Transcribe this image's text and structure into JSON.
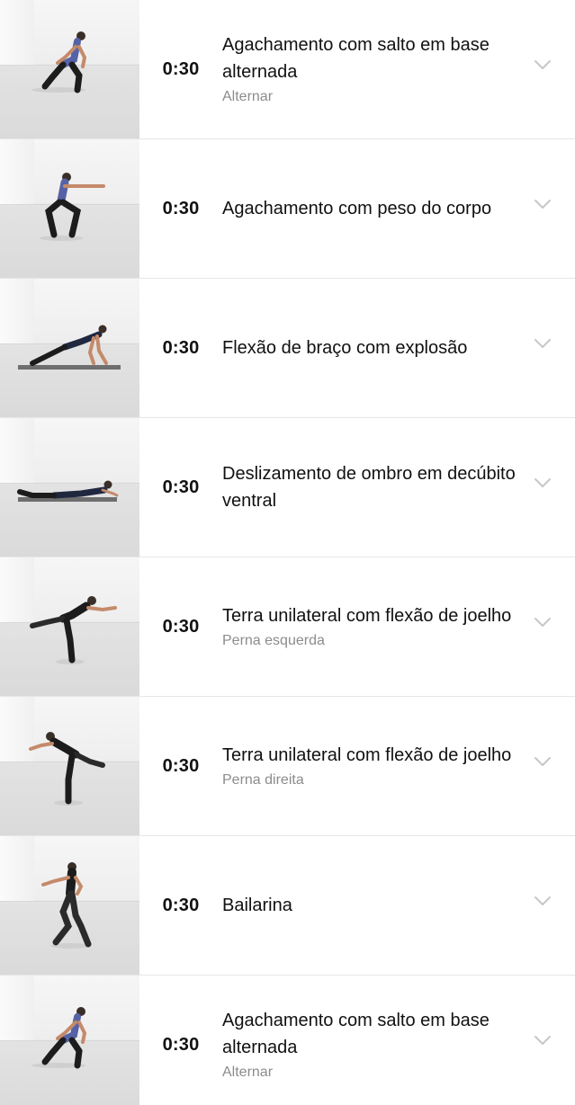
{
  "exercises": [
    {
      "time": "0:30",
      "name": "Agachamento com salto em base alternada",
      "sub": "Alternar",
      "thumb_icon": "split-squat-jump-figure"
    },
    {
      "time": "0:30",
      "name": "Agachamento com peso do corpo",
      "sub": "",
      "thumb_icon": "bodyweight-squat-figure"
    },
    {
      "time": "0:30",
      "name": "Flexão de braço com explosão",
      "sub": "",
      "thumb_icon": "plyo-pushup-figure"
    },
    {
      "time": "0:30",
      "name": "Deslizamento de ombro em decúbito ventral",
      "sub": "",
      "thumb_icon": "prone-shoulder-slide-figure"
    },
    {
      "time": "0:30",
      "name": "Terra unilateral com flexão de joelho",
      "sub": "Perna esquerda",
      "thumb_icon": "single-leg-deadlift-figure"
    },
    {
      "time": "0:30",
      "name": "Terra unilateral com flexão de joelho",
      "sub": "Perna direita",
      "thumb_icon": "single-leg-deadlift-figure"
    },
    {
      "time": "0:30",
      "name": "Bailarina",
      "sub": "",
      "thumb_icon": "bailarina-figure"
    },
    {
      "time": "0:30",
      "name": "Agachamento com salto em base alternada",
      "sub": "Alternar",
      "thumb_icon": "split-squat-jump-figure"
    }
  ],
  "colors": {
    "text": "#111111",
    "subtext": "#8c8c8c",
    "divider": "#e6e6e6",
    "chevron": "#c7c7c7"
  }
}
